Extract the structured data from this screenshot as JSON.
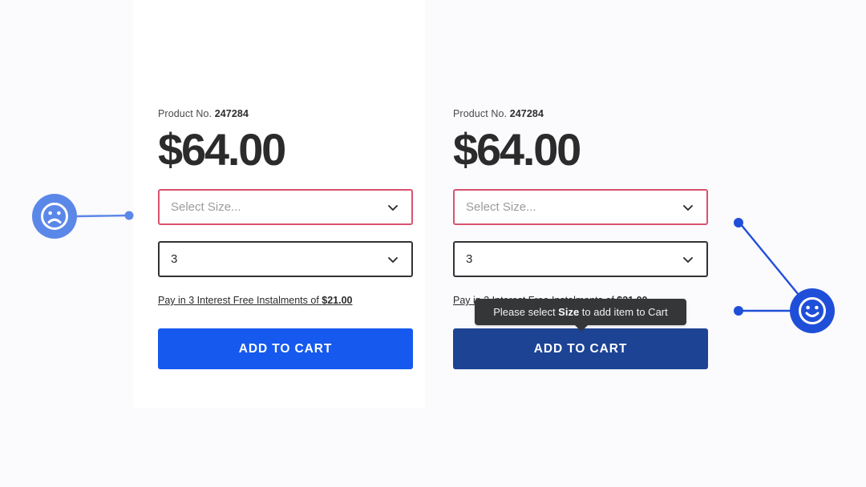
{
  "page": {
    "background_color": "#fbfafd",
    "panel_color": "#ffffff"
  },
  "products": [
    {
      "id": "left",
      "product_no_label": "Product No.",
      "sku": "247284",
      "price": "$64.00",
      "size_select": {
        "value": "Select Size...",
        "is_placeholder": true,
        "state": "error",
        "border_color": "#d9536f",
        "chevron_icon": "chevron-down-icon"
      },
      "quantity_select": {
        "value": "3",
        "is_placeholder": false,
        "state": "normal",
        "border_color": "#333333",
        "chevron_icon": "chevron-down-icon"
      },
      "instalment_text": "Pay in 3 Interest Free Instalments of ",
      "instalment_amount": "$21.00",
      "add_to_cart_label": "ADD TO CART",
      "add_to_cart_color": "#1559ef"
    },
    {
      "id": "right",
      "product_no_label": "Product No.",
      "sku": "247284",
      "price": "$64.00",
      "size_select": {
        "value": "Select Size...",
        "is_placeholder": true,
        "state": "error",
        "border_color": "#d9536f",
        "chevron_icon": "chevron-down-icon"
      },
      "quantity_select": {
        "value": "3",
        "is_placeholder": false,
        "state": "normal",
        "border_color": "#333333",
        "chevron_icon": "chevron-down-icon"
      },
      "instalment_text": "Pay in 3 Interest Free Instalments of ",
      "instalment_amount": "$21.00",
      "add_to_cart_label": "ADD TO CART",
      "add_to_cart_color": "#1c4394"
    }
  ],
  "tooltip": {
    "prefix": "Please select ",
    "emphasis": "Size",
    "suffix": " to add item to Cart",
    "background_color": "#343638",
    "text_color": "#f2f2f2"
  },
  "annotations": [
    {
      "id": "sad",
      "icon": "frowning-face-icon",
      "sentiment": "negative",
      "badge_color": "#5b87e8",
      "connector_color": "#5b87e8",
      "points_to": "size-select-left"
    },
    {
      "id": "happy",
      "icon": "smiling-face-icon",
      "sentiment": "positive",
      "badge_color": "#1f4fd8",
      "connector_color": "#1f4fd8",
      "points_to": "size-select-right-and-tooltip"
    }
  ]
}
